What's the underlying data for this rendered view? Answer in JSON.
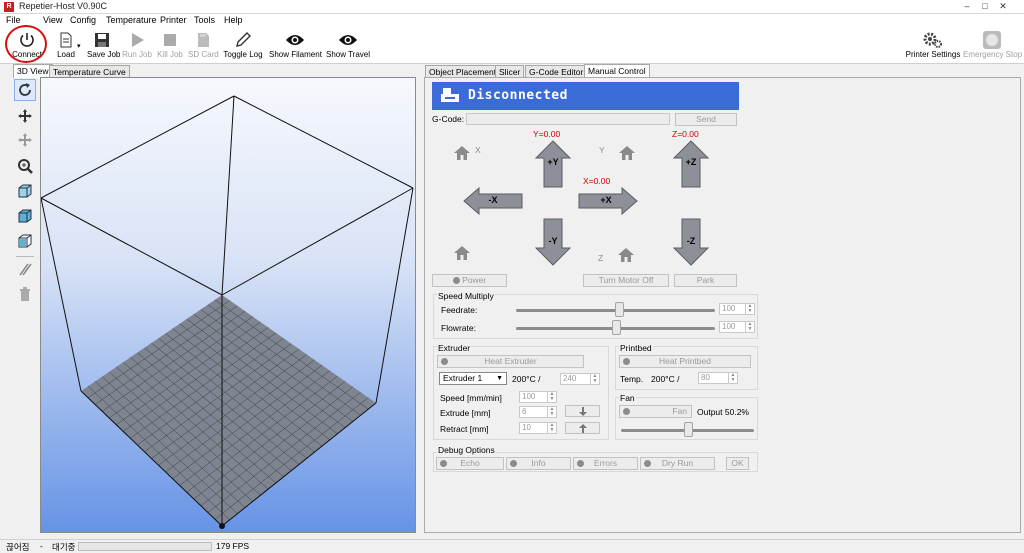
{
  "window": {
    "title": "Repetier-Host V0.90C",
    "app_icon": "R"
  },
  "menu": [
    "File",
    "View",
    "Config",
    "Temperature",
    "Printer",
    "Tools",
    "Help"
  ],
  "toolbar": {
    "connect": "Connect",
    "load": "Load",
    "save_job": "Save Job",
    "run_job": "Run Job",
    "kill_job": "Kill Job",
    "sd_card": "SD Card",
    "toggle_log": "Toggle Log",
    "show_filament": "Show Filament",
    "show_travel": "Show Travel",
    "printer_settings": "Printer Settings",
    "emergency_stop": "Emergency Stop"
  },
  "left_tabs": [
    "3D View",
    "Temperature Curve"
  ],
  "right_tabs": [
    "Object Placement",
    "Slicer",
    "G-Code Editor",
    "Manual Control"
  ],
  "manual": {
    "status": "Disconnected",
    "gcode_label": "G-Code:",
    "send": "Send",
    "y_pos": "Y=0.00",
    "z_pos": "Z=0.00",
    "x_pos": "X=0.00",
    "axis_x": "X",
    "axis_y": "Y",
    "axis_z": "Z",
    "btn_plus_y": "+Y",
    "btn_minus_y": "-Y",
    "btn_minus_x": "-X",
    "btn_plus_x": "+X",
    "btn_plus_z": "+Z",
    "btn_minus_z": "-Z",
    "power": "Power",
    "turn_motor_off": "Turn Motor Off",
    "park": "Park"
  },
  "speed": {
    "title": "Speed Multiply",
    "feedrate_label": "Feedrate:",
    "feedrate": "100",
    "feedrate_pct": 52,
    "flowrate_label": "Flowrate:",
    "flowrate": "100",
    "flowrate_pct": 50
  },
  "extruder": {
    "title": "Extruder",
    "heat": "Heat Extruder",
    "select": "Extruder 1",
    "current_temp": "200°C /",
    "target": "240",
    "speed_label": "Speed [mm/min]",
    "speed": "100",
    "extrude_label": "Extrude [mm]",
    "extrude": "6",
    "retract_label": "Retract [mm]",
    "retract": "10"
  },
  "printbed": {
    "title": "Printbed",
    "heat": "Heat Printbed",
    "temp_label": "Temp.",
    "current_temp": "200°C /",
    "target": "80"
  },
  "fan": {
    "title": "Fan",
    "btn": "Fan",
    "output": "Output 50.2%",
    "level_pct": 50.2
  },
  "debug": {
    "title": "Debug Options",
    "echo": "Echo",
    "info": "Info",
    "errors": "Errors",
    "dry_run": "Dry Run",
    "ok": "OK"
  },
  "statusbar": {
    "state": "끊어짐",
    "sep": "-",
    "idle": "대기중",
    "fps": "179 FPS"
  },
  "colors": {
    "disconnected_bg": "#3a6bd6",
    "bed": "#7f8590",
    "coord_red": "#d40000",
    "highlight": "#d41010"
  }
}
